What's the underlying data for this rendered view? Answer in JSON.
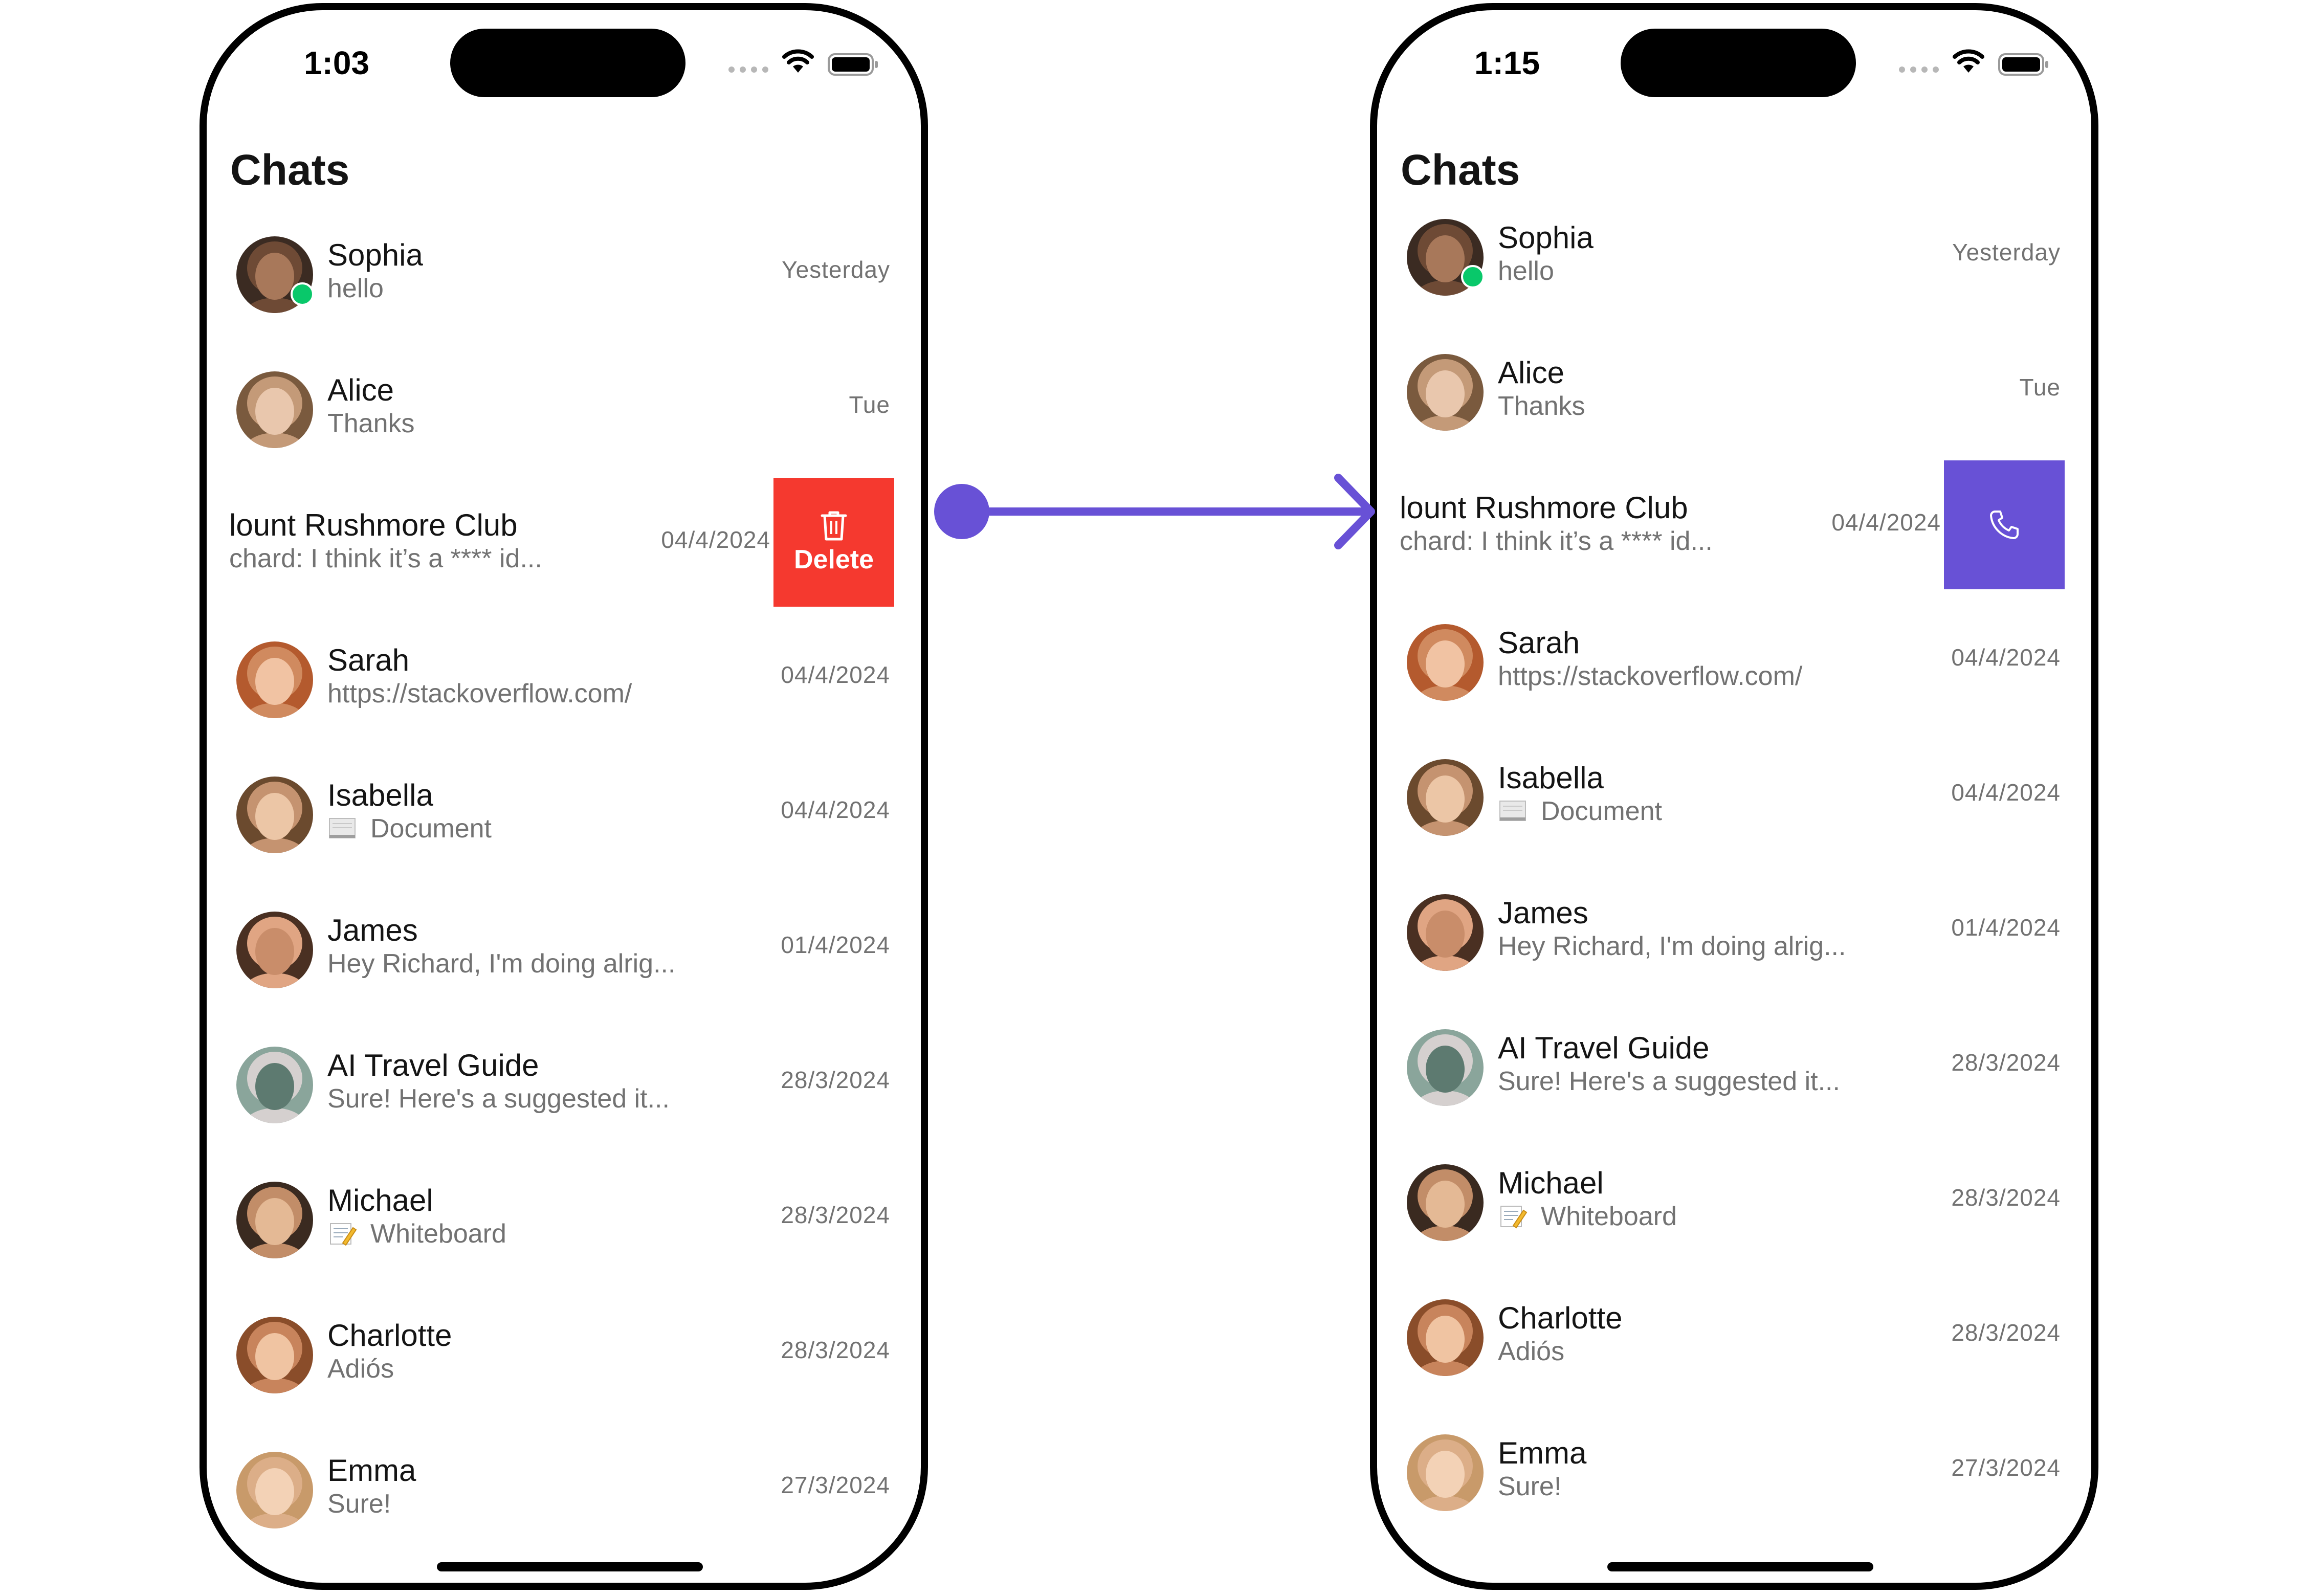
{
  "colors": {
    "accent": "#6851d6",
    "delete_red": "#f5392f",
    "online_green": "#09c86a",
    "secondary_text": "#727272"
  },
  "screens": [
    {
      "status_time": "1:03",
      "title": "Chats",
      "swiped_action": {
        "type": "delete",
        "label": "Delete",
        "icon": "trash-icon"
      },
      "chats": [
        {
          "name": "Sophia",
          "preview": "hello",
          "timestamp": "Yesterday",
          "online": true
        },
        {
          "name": "Alice",
          "preview": "Thanks",
          "timestamp": "Tue"
        },
        {
          "name": "lount Rushmore Club",
          "preview": "chard: I think it’s a **** id...",
          "timestamp": "04/4/2024",
          "swiped": true
        },
        {
          "name": "Sarah",
          "preview": "https://stackoverflow.com/",
          "timestamp": "04/4/2024"
        },
        {
          "name": "Isabella",
          "preview": "Document",
          "preview_icon": "document-icon",
          "timestamp": "04/4/2024"
        },
        {
          "name": "James",
          "preview": "Hey Richard, I'm doing alrig...",
          "timestamp": "01/4/2024"
        },
        {
          "name": "AI Travel Guide",
          "preview": "Sure! Here's a suggested it...",
          "timestamp": "28/3/2024"
        },
        {
          "name": "Michael",
          "preview": "Whiteboard",
          "preview_icon": "memo-icon",
          "timestamp": "28/3/2024"
        },
        {
          "name": "Charlotte",
          "preview": "Adiós",
          "timestamp": "28/3/2024"
        },
        {
          "name": "Emma",
          "preview": "Sure!",
          "timestamp": "27/3/2024"
        }
      ]
    },
    {
      "status_time": "1:15",
      "title": "Chats",
      "swiped_action": {
        "type": "call",
        "icon": "phone-icon"
      },
      "chats": [
        {
          "name": "Sophia",
          "preview": "hello",
          "timestamp": "Yesterday",
          "online": true
        },
        {
          "name": "Alice",
          "preview": "Thanks",
          "timestamp": "Tue"
        },
        {
          "name": "lount Rushmore Club",
          "preview": "chard: I think it’s a **** id...",
          "timestamp": "04/4/2024",
          "swiped": true
        },
        {
          "name": "Sarah",
          "preview": "https://stackoverflow.com/",
          "timestamp": "04/4/2024"
        },
        {
          "name": "Isabella",
          "preview": "Document",
          "preview_icon": "document-icon",
          "timestamp": "04/4/2024"
        },
        {
          "name": "James",
          "preview": "Hey Richard, I'm doing alrig...",
          "timestamp": "01/4/2024"
        },
        {
          "name": "AI Travel Guide",
          "preview": "Sure! Here's a suggested it...",
          "timestamp": "28/3/2024"
        },
        {
          "name": "Michael",
          "preview": "Whiteboard",
          "preview_icon": "memo-icon",
          "timestamp": "28/3/2024"
        },
        {
          "name": "Charlotte",
          "preview": "Adiós",
          "timestamp": "28/3/2024"
        },
        {
          "name": "Emma",
          "preview": "Sure!",
          "timestamp": "27/3/2024"
        }
      ]
    }
  ]
}
